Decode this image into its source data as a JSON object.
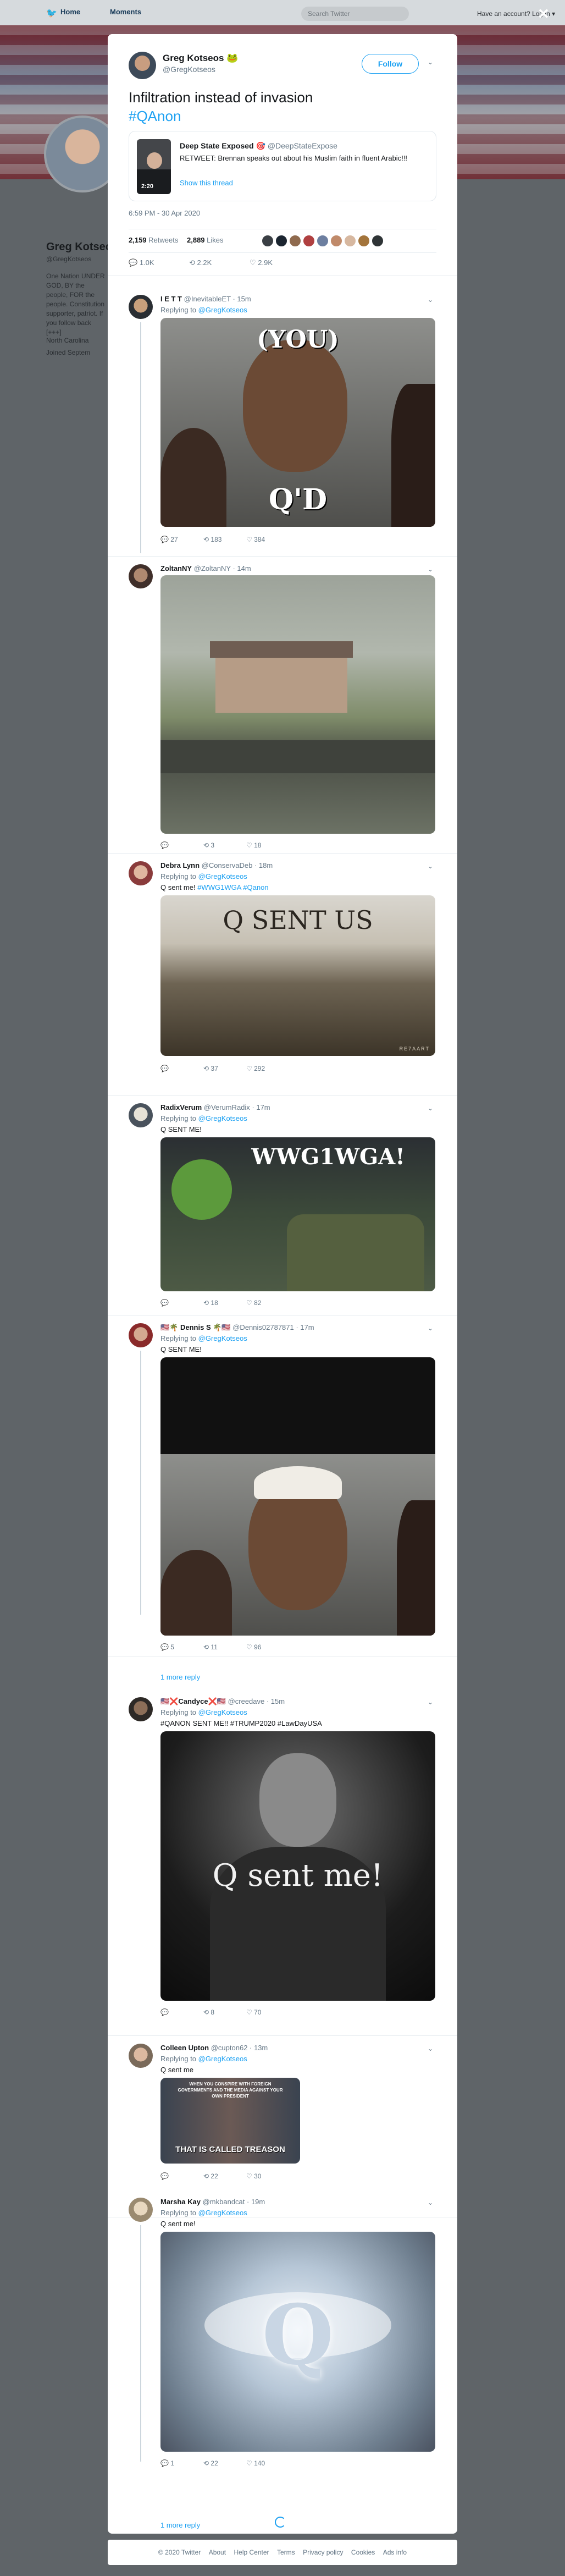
{
  "nav": {
    "home_label": "Home",
    "moments_label": "Moments",
    "search_placeholder": "Search Twitter",
    "account_text": "Have an account? Log in ▾",
    "close_glyph": "✕"
  },
  "profile_bg": {
    "name": "Greg Kotsec",
    "handle": "@GregKotseos",
    "bio": "One Nation UNDER GOD, BY the people, FOR the people. Constitution supporter, patriot. If you follow back [+++]",
    "location": "North Carolina",
    "joined": "Joined Septem"
  },
  "main_tweet": {
    "name": "Greg Kotseos 🐸",
    "handle": "@GregKotseos",
    "follow_label": "Follow",
    "caret": "⌄",
    "text": "Infiltration instead of invasion",
    "hashtag": "#QAnon",
    "quote": {
      "name": "Deep State Exposed",
      "name_suffix": "🎯",
      "handle": "@DeepStateExpose",
      "text": "RETWEET: Brennan speaks out about his Muslim faith in fluent Arabic!!!",
      "link": "Show this thread",
      "video_time": "2:20"
    },
    "date": "6:59 PM - 30 Apr 2020",
    "retweets_count": "2,159",
    "retweets_label": "Retweets",
    "likes_count": "2,889",
    "likes_label": "Likes",
    "actions": {
      "replies": "1.0K",
      "retweets": "2.2K",
      "likes": "2.9K"
    }
  },
  "replies": [
    {
      "name": "I E T T",
      "handle": "@InevitableET · 15m",
      "replying": "Replying to",
      "to": "@GregKotseos",
      "text": "",
      "caption": "(YOU)",
      "caption2": "Q'D",
      "counts": {
        "replies": "27",
        "retweets": "183",
        "likes": "384"
      }
    },
    {
      "name": "ZoltanNY",
      "handle": "@ZoltanNY · 14m",
      "replying": "",
      "to": "",
      "text": "",
      "counts": {
        "replies": "",
        "retweets": "3",
        "likes": "18"
      }
    },
    {
      "name": "Debra Lynn",
      "handle": "@ConservaDeb · 18m",
      "replying": "Replying to",
      "to": "@GregKotseos",
      "text": "Q sent me!",
      "text_tags": "#WWG1WGA #Qanon",
      "caption": "Q SENT US",
      "watermark": "RE7AART",
      "counts": {
        "replies": "",
        "retweets": "37",
        "likes": "292"
      }
    },
    {
      "name": "RadixVerum",
      "handle": "@VerumRadix · 17m",
      "replying": "Replying to",
      "to": "@GregKotseos",
      "text": "Q SENT ME!",
      "caption": "WWG1WGA!",
      "counts": {
        "replies": "",
        "retweets": "18",
        "likes": "82"
      }
    },
    {
      "name": "🇺🇸🌴 Dennis S 🌴🇺🇸",
      "handle": "@Dennis02787871 · 17m",
      "replying": "Replying to",
      "to": "@GregKotseos",
      "text": "Q SENT ME!",
      "counts": {
        "replies": "5",
        "retweets": "11",
        "likes": "96"
      },
      "more": "1 more reply"
    },
    {
      "name": "🇺🇸❌Candyce❌🇺🇸",
      "handle": "@creedave · 15m",
      "replying": "Replying to",
      "to": "@GregKotseos",
      "text": "#QANON SENT ME!! #TRUMP2020 #LawDayUSA",
      "caption": "Q sent me!",
      "counts": {
        "replies": "",
        "retweets": "8",
        "likes": "70"
      }
    },
    {
      "name": "Colleen Upton",
      "handle": "@cupton62 · 13m",
      "replying": "Replying to",
      "to": "@GregKotseos",
      "text": "Q sent me",
      "caption_top": "WHEN YOU CONSPIRE WITH FOREIGN GOVERNMENTS AND THE MEDIA AGAINST YOUR OWN PRESIDENT",
      "caption_bottom": "THAT IS CALLED TREASON",
      "counts": {
        "replies": "",
        "retweets": "22",
        "likes": "30"
      }
    },
    {
      "name": "Marsha Kay",
      "handle": "@mkbandcat · 19m",
      "replying": "Replying to",
      "to": "@GregKotseos",
      "text": "Q sent me!",
      "caption": "Q",
      "counts": {
        "replies": "1",
        "retweets": "22",
        "likes": "140"
      },
      "more": "1 more reply"
    }
  ],
  "footer": [
    "© 2020 Twitter",
    "About",
    "Help Center",
    "Terms",
    "Privacy policy",
    "Cookies",
    "Ads info"
  ],
  "colors": {
    "accent": "#1da1f2",
    "muted": "#657786",
    "overlay": "#5a6066"
  }
}
